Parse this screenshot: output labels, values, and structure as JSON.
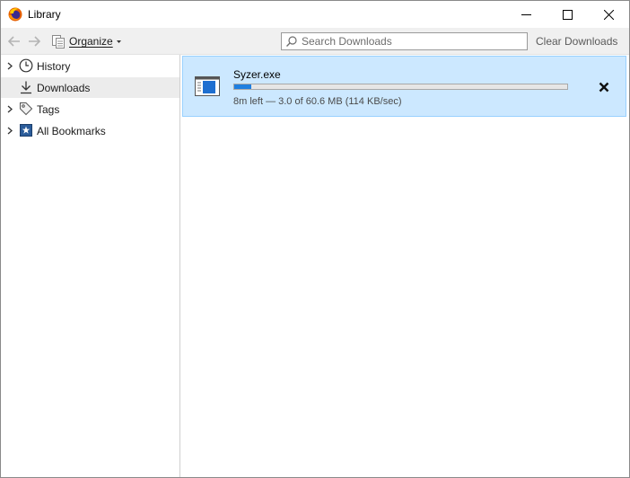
{
  "window": {
    "title": "Library",
    "app_icon": "firefox-icon",
    "controls": [
      "minimize-icon",
      "maximize-icon",
      "close-icon"
    ]
  },
  "toolbar": {
    "back_icon": "arrow-left-icon",
    "forward_icon": "arrow-right-icon",
    "organize_icon": "organize-icon",
    "organize_label": "Organize",
    "search_placeholder": "Search Downloads",
    "search_value": "",
    "clear_label": "Clear Downloads"
  },
  "sidebar": {
    "items": [
      {
        "label": "History",
        "icon": "clock-icon",
        "expandable": true,
        "selected": false
      },
      {
        "label": "Downloads",
        "icon": "download-icon",
        "expandable": false,
        "selected": true
      },
      {
        "label": "Tags",
        "icon": "tag-icon",
        "expandable": true,
        "selected": false
      },
      {
        "label": "All Bookmarks",
        "icon": "bookmarks-icon",
        "expandable": true,
        "selected": false
      }
    ]
  },
  "downloads": [
    {
      "filename": "Syzer.exe",
      "status": "8m left — 3.0 of 60.6 MB (114 KB/sec)",
      "progress_fraction": 0.05,
      "icon": "executable-file-icon",
      "cancel_icon": "cancel-download-icon"
    }
  ],
  "colors": {
    "selected_row_bg": "#cce8ff",
    "selected_row_border": "#99d1ff",
    "progress_fill": "#1f7fe0",
    "toolbar_bg": "#f0f0f0",
    "sidebar_selected_bg": "#ececec"
  }
}
